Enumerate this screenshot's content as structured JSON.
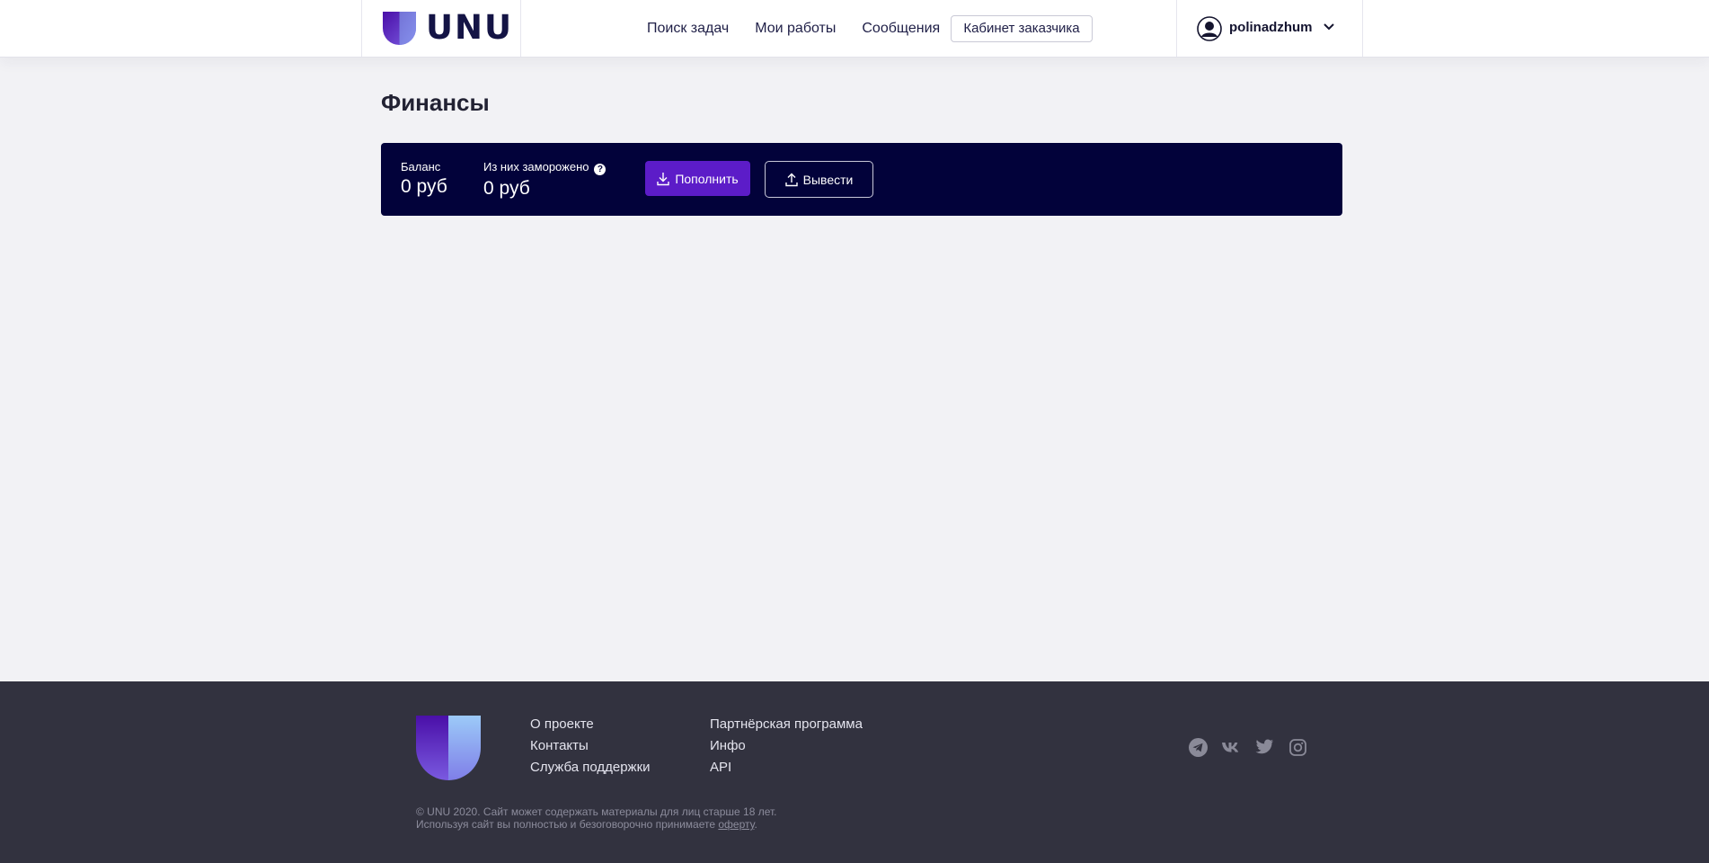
{
  "header": {
    "logo_text": "UNU",
    "nav": [
      "Поиск задач",
      "Мои работы",
      "Сообщения"
    ],
    "cabinet_button": "Кабинет заказчика",
    "username": "polinadzhum"
  },
  "main": {
    "title": "Финансы",
    "balance_label": "Баланс",
    "balance_value": "0 руб",
    "frozen_label": "Из них заморожено",
    "frozen_value": "0 руб",
    "topup_button": "Пополнить",
    "withdraw_button": "Вывести"
  },
  "footer": {
    "col1": [
      "О проекте",
      "Контакты",
      "Служба поддержки"
    ],
    "col2": [
      "Партнёрская программа",
      "Инфо",
      "API"
    ],
    "socials": [
      "telegram-icon",
      "vk-icon",
      "twitter-icon",
      "instagram-icon"
    ],
    "copyright_line1": "© UNU 2020. Сайт может содержать материалы для лиц старше 18 лет.",
    "copyright_line2": "Используя сайт вы полностью и безоговорочно принимаете",
    "offer_link": "оферту",
    "offer_suffix": "."
  },
  "colors": {
    "accent": "#5c1cc8",
    "panel": "#02023a",
    "footer": "#32323f",
    "page_bg": "#f2f2f5"
  }
}
